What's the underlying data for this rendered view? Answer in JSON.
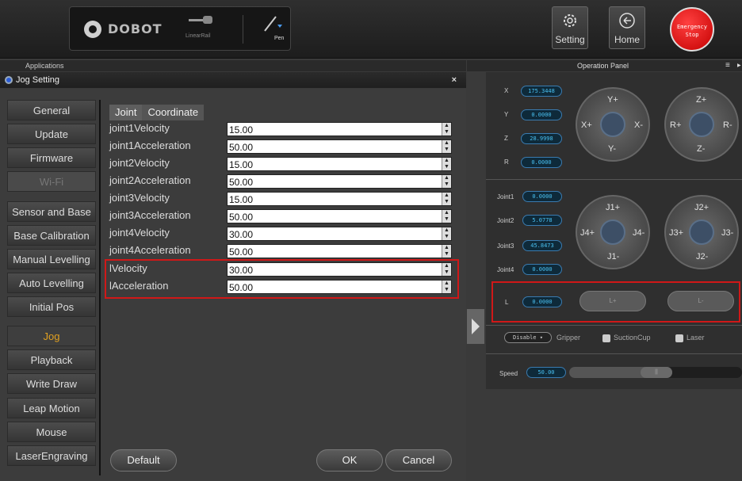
{
  "brand": {
    "name": "DOBOT",
    "rail_label": "LinearRail",
    "tool_label": "Pen"
  },
  "topbar": {
    "setting_label": "Setting",
    "home_label": "Home",
    "estop_line1": "Emergency",
    "estop_line2": "Stop"
  },
  "applications_label": "Applications",
  "operation_panel_label": "Operation Panel",
  "jog_setting": {
    "title": "Jog Setting",
    "close": "×"
  },
  "sidebar": {
    "group1": [
      "General",
      "Update",
      "Firmware",
      "Wi-Fi"
    ],
    "group2": [
      "Sensor and Base",
      "Base Calibration",
      "Manual Levelling",
      "Auto Levelling",
      "Initial Pos"
    ],
    "group3": [
      "Jog",
      "Playback",
      "Write  Draw",
      "Leap Motion",
      "Mouse",
      "LaserEngraving"
    ]
  },
  "tabs": [
    "Joint",
    "Coordinate"
  ],
  "rows": [
    {
      "label": "joint1Velocity",
      "value": "15.00"
    },
    {
      "label": "joint1Acceleration",
      "value": "50.00"
    },
    {
      "label": "joint2Velocity",
      "value": "15.00"
    },
    {
      "label": "joint2Acceleration",
      "value": "50.00"
    },
    {
      "label": "joint3Velocity",
      "value": "15.00"
    },
    {
      "label": "joint3Acceleration",
      "value": "50.00"
    },
    {
      "label": "joint4Velocity",
      "value": "30.00"
    },
    {
      "label": "joint4Acceleration",
      "value": "50.00"
    },
    {
      "label": "lVelocity",
      "value": "30.00"
    },
    {
      "label": "lAcceleration",
      "value": "50.00"
    }
  ],
  "buttons": {
    "default": "Default",
    "ok": "OK",
    "cancel": "Cancel"
  },
  "coords": {
    "x_label": "X",
    "x": "175.3448",
    "y_label": "Y",
    "y": "0.0000",
    "z_label": "Z",
    "z": "28.9998",
    "r_label": "R",
    "r": "0.0000"
  },
  "joints": {
    "j1_label": "Joint1",
    "j1": "0.0000",
    "j2_label": "Joint2",
    "j2": "5.0778",
    "j3_label": "Joint3",
    "j3": "45.8473",
    "j4_label": "Joint4",
    "j4": "0.0000"
  },
  "wheels": {
    "xy": {
      "top": "Y+",
      "bottom": "Y-",
      "left": "X+",
      "right": "X-"
    },
    "zr": {
      "top": "Z+",
      "bottom": "Z-",
      "left": "R+",
      "right": "R-"
    },
    "j14": {
      "top": "J1+",
      "bottom": "J1-",
      "left": "J4+",
      "right": "J4-"
    },
    "j23": {
      "top": "J2+",
      "bottom": "J2-",
      "left": "J3+",
      "right": "J3-"
    }
  },
  "linear": {
    "label": "L",
    "value": "0.0000",
    "plus": "L+",
    "minus": "L-"
  },
  "end_effector": {
    "mode": "Disable",
    "gripper": "Gripper",
    "suction": "SuctionCup",
    "laser": "Laser"
  },
  "speed": {
    "label": "Speed",
    "value": "50.00",
    "handle": "||"
  },
  "colors": {
    "accent": "#e0a020",
    "highlight": "#d01818",
    "value": "#49c0f0"
  }
}
